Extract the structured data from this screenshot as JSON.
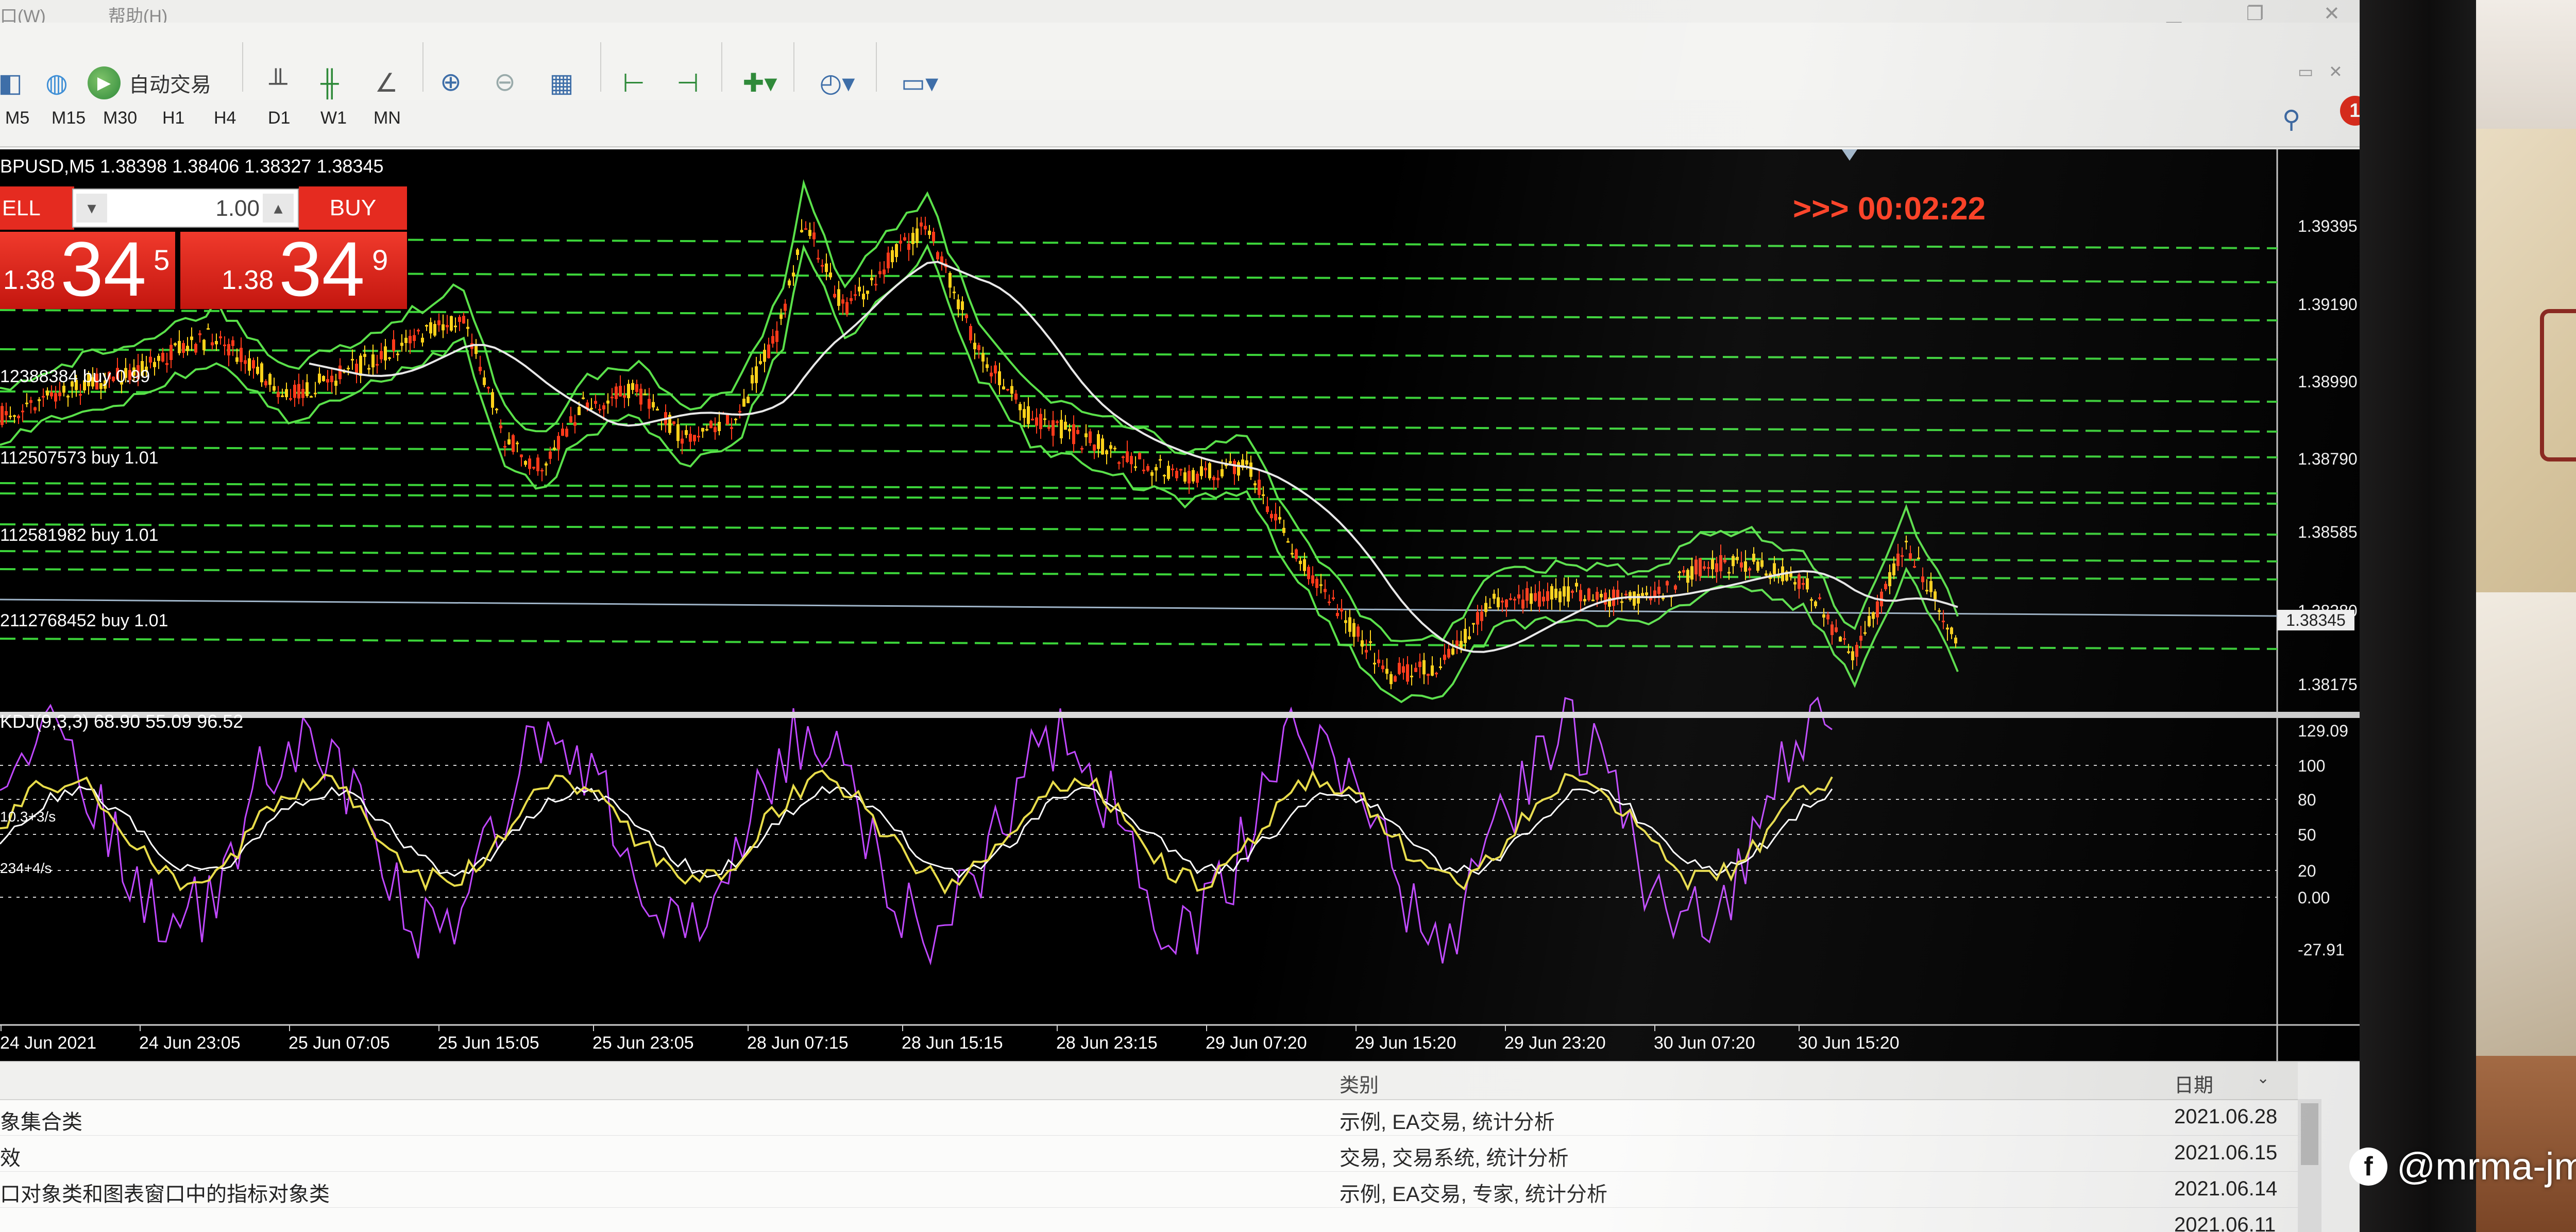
{
  "menu": {
    "window": "口(W)",
    "help": "帮助(H)"
  },
  "toolbar": {
    "auto_trade": "自动交易"
  },
  "timeframes": [
    "M5",
    "M15",
    "M30",
    "H1",
    "H4",
    "D1",
    "W1",
    "MN"
  ],
  "notification_count": "1",
  "chart": {
    "symbol_info": "BPUSD,M5  1.38398 1.38406 1.38327 1.38345",
    "timer": ">>> 00:02:22",
    "current_price": "1.38345",
    "trade_panel": {
      "sell_label": "ELL",
      "buy_label": "BUY",
      "lot": "1.00",
      "sell_small": "1.38",
      "sell_big": "34",
      "sell_sup": "5",
      "buy_small": "1.38",
      "buy_big": "34",
      "buy_sup": "9"
    },
    "trade_labels": [
      "12388384 buy 0.99",
      "112507573 buy 1.01",
      "112581982 buy 1.01",
      "2112768452 buy 1.01"
    ],
    "price_ticks": [
      "1.39395",
      "1.39190",
      "1.38990",
      "1.38790",
      "1.38585",
      "1.38380",
      "1.38175"
    ],
    "oscillator_info": "KDJ(9,3,3) 68.90 55.09 96.52",
    "osc_side_labels": [
      "10.3+3/s",
      "234+4/s"
    ],
    "osc_ticks": [
      "129.09",
      "100",
      "80",
      "50",
      "20",
      "0.00",
      "-27.91"
    ],
    "time_ticks": [
      "24 Jun 2021",
      "24 Jun 23:05",
      "25 Jun 07:05",
      "25 Jun 15:05",
      "25 Jun 23:05",
      "28 Jun 07:15",
      "28 Jun 15:15",
      "28 Jun 23:15",
      "29 Jun 07:20",
      "29 Jun 15:20",
      "29 Jun 23:20",
      "30 Jun 07:20",
      "30 Jun 15:20"
    ]
  },
  "table": {
    "headers": {
      "category": "类别",
      "date": "日期"
    },
    "rows": [
      {
        "name": "象集合类",
        "category": "示例, EA交易, 统计分析",
        "date": "2021.06.28"
      },
      {
        "name": "效",
        "category": "交易, 交易系统, 统计分析",
        "date": "2021.06.15"
      },
      {
        "name": "口对象类和图表窗口中的指标对象类",
        "category": "示例, EA交易, 专家, 统计分析",
        "date": "2021.06.14"
      },
      {
        "name": "",
        "category": "",
        "date": "2021.06.11"
      }
    ]
  },
  "watermark": "@mrma-jm",
  "colors": {
    "sell_buy_red": "#e52b20",
    "timer_red": "#ff3b1f",
    "candle_red": "#ff3a1a",
    "candle_yellow": "#ffd21a",
    "band_green": "#5ae04a",
    "ma_white": "#e8e8e8",
    "level_green": "#3cd43a",
    "k_line": "#e8dc4a",
    "j_line": "#c048ff"
  }
}
